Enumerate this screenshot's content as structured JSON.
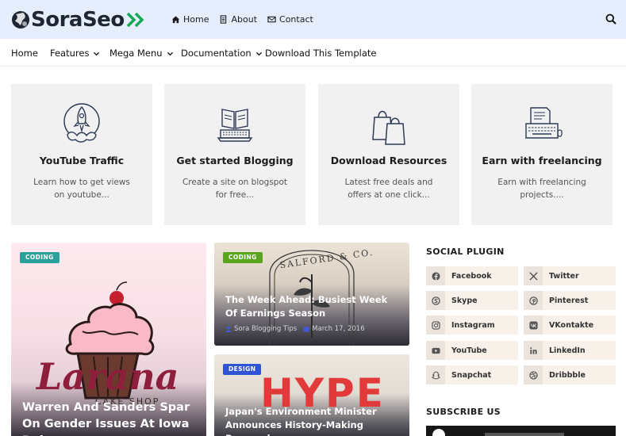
{
  "header": {
    "logo_text": "SoraSeo",
    "links": [
      {
        "label": "Home",
        "icon": "home-icon"
      },
      {
        "label": "About",
        "icon": "document-icon"
      },
      {
        "label": "Contact",
        "icon": "envelope-icon"
      }
    ]
  },
  "nav": {
    "items": [
      {
        "label": "Home",
        "has_dropdown": false
      },
      {
        "label": "Features",
        "has_dropdown": true
      },
      {
        "label": "Mega Menu",
        "has_dropdown": true
      },
      {
        "label": "Documentation",
        "has_dropdown": true
      },
      {
        "label": "Download This Template",
        "has_dropdown": false
      }
    ]
  },
  "features": [
    {
      "title": "YouTube Traffic",
      "desc": "Learn how to get views on youtube...",
      "icon": "rocket-icon"
    },
    {
      "title": "Get started Blogging",
      "desc": "Create a site on blogspot for free...",
      "icon": "laptop-book-icon"
    },
    {
      "title": "Download Resources",
      "desc": "Latest free deals and offers at one click...",
      "icon": "shopping-bags-icon"
    },
    {
      "title": "Earn with freelancing",
      "desc": "Earn with freelancing projects....",
      "icon": "typewriter-icon"
    }
  ],
  "posts": {
    "big": {
      "label": "CODING",
      "label_color": "#2aa198",
      "title": "Warren And Sanders Spar On Gender Issues At Iowa Debate",
      "image_text": "Larana",
      "image_subtext": "CAKE SHOP"
    },
    "a": {
      "label": "CODING",
      "label_color": "#5aa51d",
      "title": "The Week Ahead: Busiest Week Of Earnings Season",
      "author": "Sora Blogging Tips",
      "date": "March 17, 2016",
      "image_text": "SALFORD & CO."
    },
    "b": {
      "label": "DESIGN",
      "label_color": "#2f54d6",
      "title": "Japan's Environment Minister Announces History-Making Personal...",
      "image_text": "HYPE"
    }
  },
  "sidebar": {
    "social_heading": "SOCIAL PLUGIN",
    "social": [
      {
        "label": "Facebook",
        "icon": "facebook-icon"
      },
      {
        "label": "Twitter",
        "icon": "twitter-x-icon"
      },
      {
        "label": "Skype",
        "icon": "skype-icon"
      },
      {
        "label": "Pinterest",
        "icon": "pinterest-icon"
      },
      {
        "label": "Instagram",
        "icon": "instagram-icon"
      },
      {
        "label": "VKontakte",
        "icon": "vk-icon"
      },
      {
        "label": "YouTube",
        "icon": "youtube-icon"
      },
      {
        "label": "LinkedIn",
        "icon": "linkedin-icon"
      },
      {
        "label": "Snapchat",
        "icon": "snapchat-icon"
      },
      {
        "label": "Dribbble",
        "icon": "dribbble-icon"
      }
    ],
    "subscribe_heading": "SUBSCRIBE US"
  },
  "colors": {
    "header_bg": "#e6edfd",
    "card_bg": "#f1f1f1",
    "social_bg": "#f7f1ea",
    "accent_teal": "#2aa198",
    "accent_green": "#5aa51d",
    "accent_blue": "#2f54d6"
  }
}
